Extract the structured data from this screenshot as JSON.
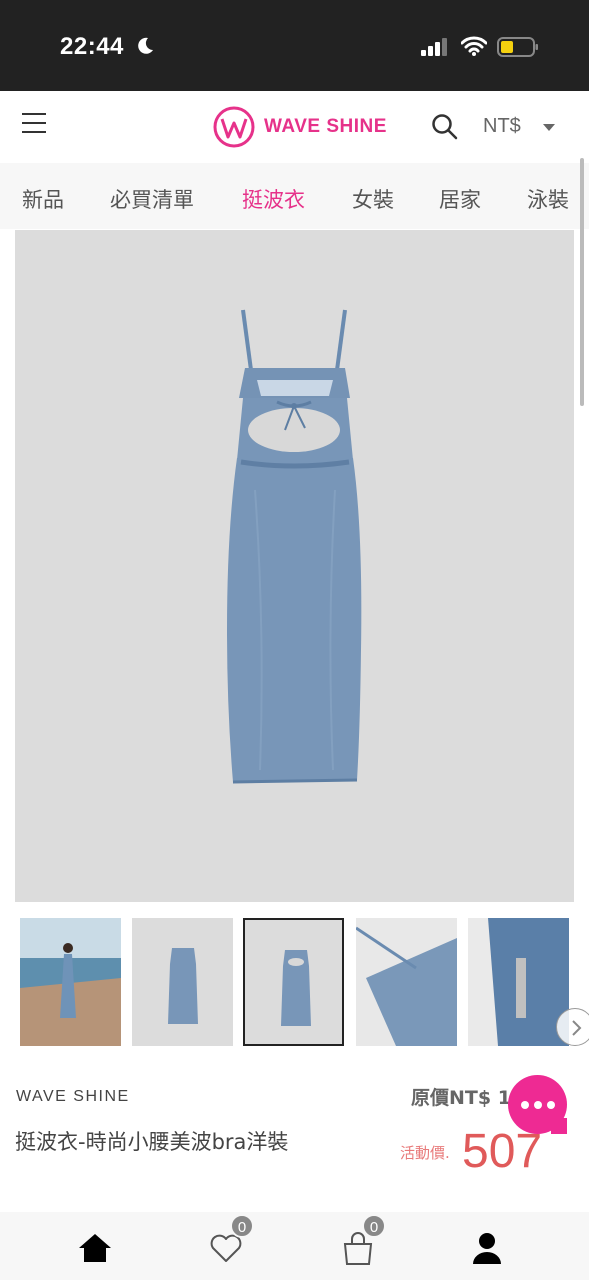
{
  "status_bar": {
    "time": "22:44"
  },
  "header": {
    "brand_name": "WAVE SHINE",
    "currency": "NT$",
    "accent_color": "#e6328a"
  },
  "tabs": [
    {
      "label": "新品",
      "active": false
    },
    {
      "label": "必買清單",
      "active": false
    },
    {
      "label": "挺波衣",
      "active": true
    },
    {
      "label": "女裝",
      "active": false
    },
    {
      "label": "居家",
      "active": false
    },
    {
      "label": "泳裝",
      "active": false
    }
  ],
  "product": {
    "brand": "WAVE SHINE",
    "name": "挺波衣-時尚小腰美波bra洋裝",
    "original_price_label": "原價NT$ 1",
    "sale_label": "活動價.",
    "sale_price": "507",
    "images": [
      "model-photo",
      "dress-front",
      "dress-back",
      "strap-detail",
      "zipper-detail"
    ],
    "selected_image_index": 2
  },
  "bottom_nav": {
    "items": [
      {
        "name": "home-icon"
      },
      {
        "name": "heart-icon",
        "badge": "0"
      },
      {
        "name": "bag-icon",
        "badge": "0"
      },
      {
        "name": "user-icon"
      }
    ]
  }
}
